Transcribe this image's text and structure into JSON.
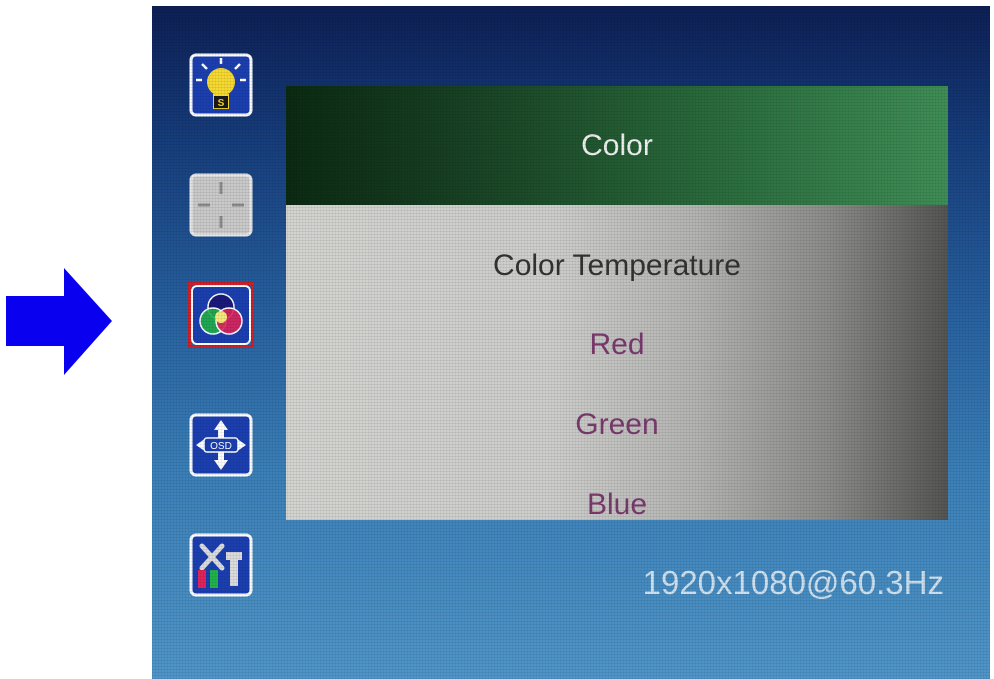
{
  "side_icons": [
    {
      "name": "brightness-icon",
      "selected": false
    },
    {
      "name": "image-position-icon",
      "selected": false
    },
    {
      "name": "color-icon",
      "selected": true
    },
    {
      "name": "osd-position-icon",
      "selected": false
    },
    {
      "name": "setup-tools-icon",
      "selected": false
    }
  ],
  "panel": {
    "title": "Color",
    "items": [
      {
        "label": "Color Temperature",
        "active": true
      },
      {
        "label": "Red",
        "active": false
      },
      {
        "label": "Green",
        "active": false
      },
      {
        "label": "Blue",
        "active": false
      }
    ]
  },
  "status": {
    "resolution": "1920x1080@60.3Hz"
  },
  "colors": {
    "pointer_arrow": "#0a00f0",
    "selection_border": "#cf1f2a",
    "header_green": "#2a6b3c",
    "item_text": "#7a3a6e",
    "active_item_text": "#333333",
    "osd_background": "#27609f"
  },
  "pointer": {
    "icon": "right-arrow-icon"
  }
}
